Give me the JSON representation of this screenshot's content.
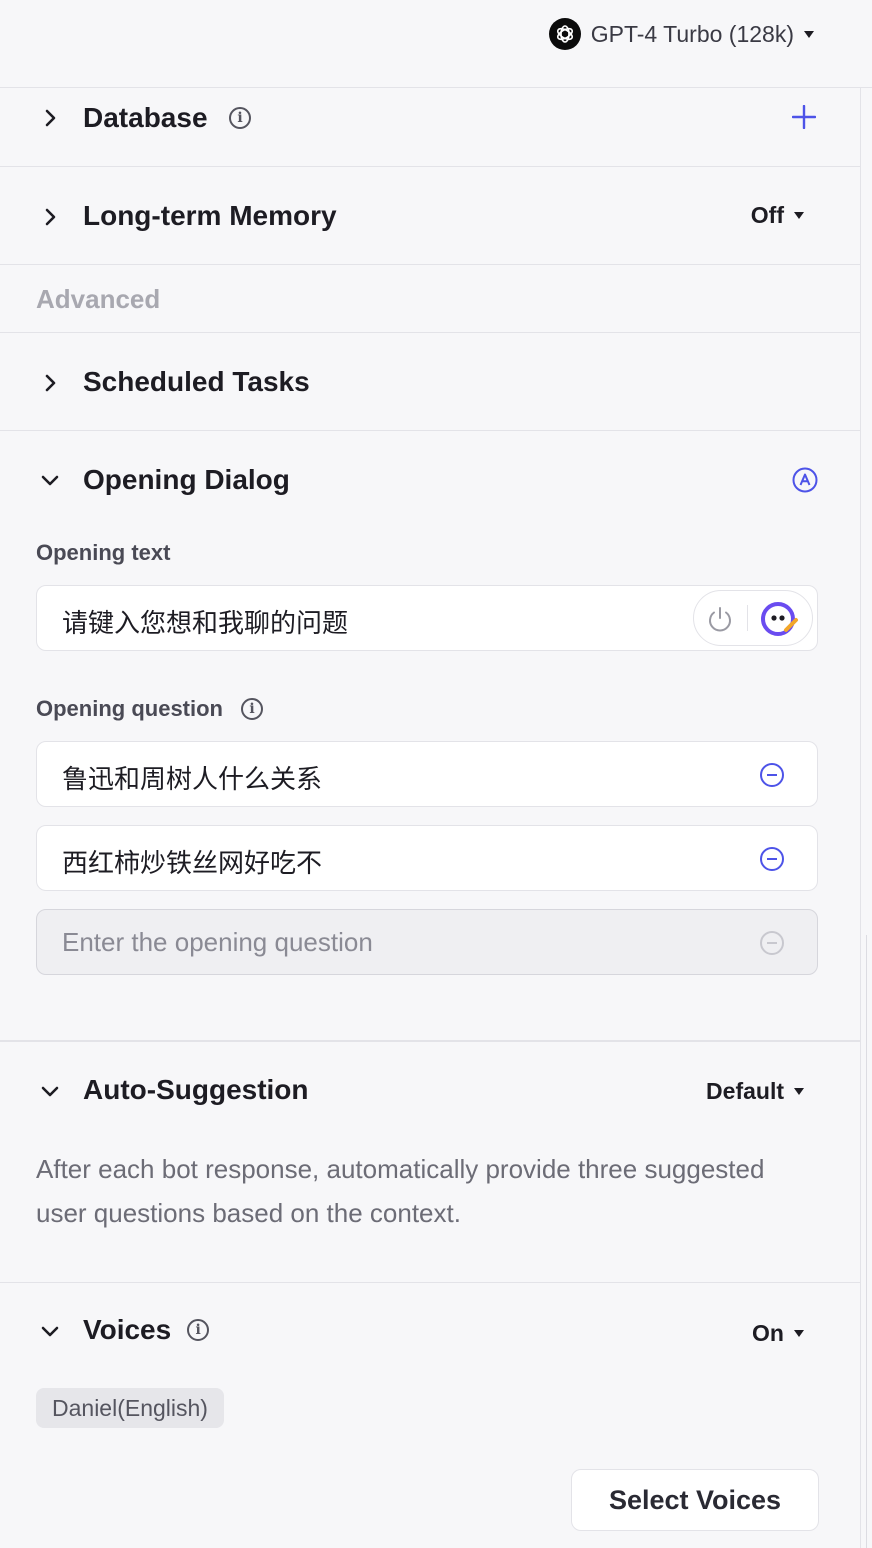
{
  "header": {
    "model_name": "GPT-4 Turbo (128k)"
  },
  "sections": {
    "database": {
      "title": "Database"
    },
    "memory": {
      "title": "Long-term Memory",
      "value": "Off"
    },
    "advanced": {
      "label": "Advanced"
    },
    "scheduled": {
      "title": "Scheduled Tasks"
    },
    "opening": {
      "title": "Opening Dialog",
      "text_label": "Opening text",
      "text_value": "请键入您想和我聊的问题",
      "question_label": "Opening question",
      "questions": [
        "鲁迅和周树人什么关系",
        "西红柿炒铁丝网好吃不"
      ],
      "placeholder": "Enter the opening question"
    },
    "suggestion": {
      "title": "Auto-Suggestion",
      "value": "Default",
      "description": "After each bot response, automatically provide three suggested user questions based on the context."
    },
    "voices": {
      "title": "Voices",
      "value": "On",
      "tag": "Daniel(English)",
      "button": "Select Voices"
    }
  },
  "colors": {
    "accent": "#4d53e8",
    "muted": "#a8a8b0",
    "background": "#f7f7f9"
  }
}
